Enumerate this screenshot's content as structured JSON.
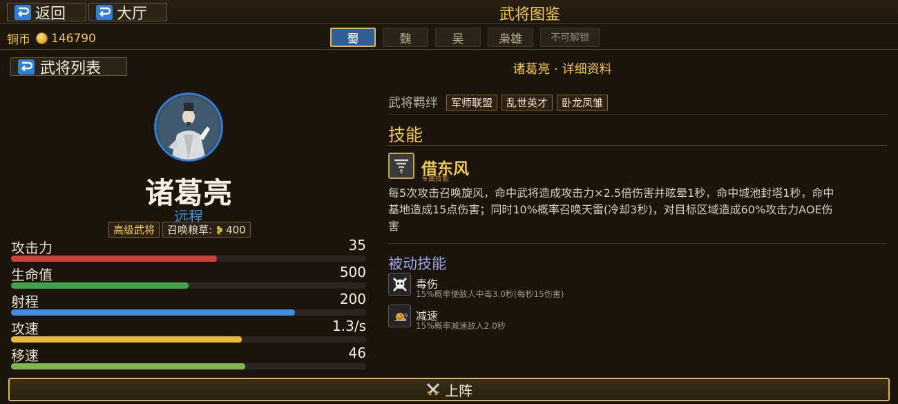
{
  "header": {
    "back_label": "返回",
    "hall_label": "大厅",
    "title": "武将图鉴"
  },
  "currency": {
    "label": "铜币",
    "amount": "146790"
  },
  "tabs": [
    {
      "label": "蜀",
      "active": true
    },
    {
      "label": "魏",
      "active": false
    },
    {
      "label": "吴",
      "active": false
    },
    {
      "label": "枭雄",
      "active": false
    },
    {
      "label": "不可解锁",
      "active": false
    }
  ],
  "left": {
    "list_button": "武将列表",
    "hero_name": "诸葛亮",
    "hero_type": "远程",
    "rank_tag": "高级武将",
    "summon_label": "召唤粮草:",
    "summon_cost": "400",
    "stats": [
      {
        "label": "攻击力",
        "value": "35",
        "fill": 0.58,
        "color": "#c8433a"
      },
      {
        "label": "生命值",
        "value": "500",
        "fill": 0.5,
        "color": "#3fa34a"
      },
      {
        "label": "射程",
        "value": "200",
        "fill": 0.8,
        "color": "#3f8fe0"
      },
      {
        "label": "攻速",
        "value": "1.3/s",
        "fill": 0.65,
        "color": "#e8b93a"
      },
      {
        "label": "移速",
        "value": "46",
        "fill": 0.66,
        "color": "#7cb84a"
      }
    ]
  },
  "right": {
    "title": "诸葛亮 · 详细资料",
    "bond_label": "武将羁绊",
    "bonds": [
      "军师联盟",
      "乱世英才",
      "卧龙凤雏"
    ],
    "skill_heading": "技能",
    "skill": {
      "name": "借东风",
      "subtitle": "专属技能",
      "description": "每5次攻击召唤旋风，命中武将造成攻击力×2.5倍伤害并眩晕1秒，命中城池封塔1秒，命中基地造成15点伤害；同时10%概率召唤天雷(冷却3秒)，对目标区域造成60%攻击力AOE伤害"
    },
    "passive_heading": "被动技能",
    "passives": [
      {
        "name": "毒伤",
        "desc": "15%概率使敌人中毒3.0秒(每秒15伤害)",
        "icon": "skull-crossbones-icon"
      },
      {
        "name": "减速",
        "desc": "15%概率减速敌人2.0秒",
        "icon": "snail-icon"
      }
    ]
  },
  "deploy_label": "上阵"
}
